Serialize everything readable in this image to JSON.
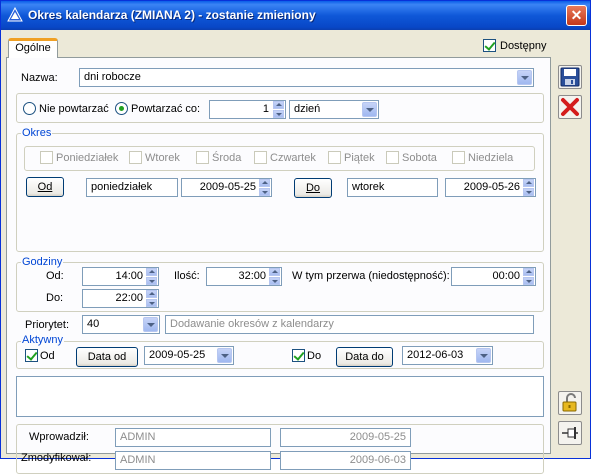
{
  "window": {
    "title": "Okres kalendarza (ZMIANA 2) - zostanie zmieniony"
  },
  "tabs": [
    {
      "label": "Ogólne"
    }
  ],
  "dostepny": {
    "label": "Dostępny",
    "checked": true
  },
  "nazwa": {
    "label": "Nazwa:",
    "value": "dni robocze"
  },
  "repeat": {
    "no_repeat_label": "Nie powtarzać",
    "repeat_label": "Powtarzać co:",
    "selected": "repeat",
    "count": "1",
    "unit": "dzień"
  },
  "okres": {
    "title": "Okres",
    "days": [
      {
        "label": "Poniedziałek",
        "checked": false
      },
      {
        "label": "Wtorek",
        "checked": false
      },
      {
        "label": "Środa",
        "checked": false
      },
      {
        "label": "Czwartek",
        "checked": false
      },
      {
        "label": "Piątek",
        "checked": false
      },
      {
        "label": "Sobota",
        "checked": false
      },
      {
        "label": "Niedziela",
        "checked": false
      }
    ],
    "od_button": "Od",
    "od_day": "poniedziałek",
    "od_date": "2009-05-25",
    "do_button": "Do",
    "do_day": "wtorek",
    "do_date": "2009-05-26"
  },
  "godziny": {
    "title": "Godziny",
    "od_label": "Od:",
    "od_value": "14:00",
    "do_label": "Do:",
    "do_value": "22:00",
    "ilosc_label": "Ilość:",
    "ilosc_value": "32:00",
    "przerwa_label": "W tym przerwa (niedostępność):",
    "przerwa_value": "00:00"
  },
  "priorytet": {
    "label": "Priorytet:",
    "value": "40",
    "description": "Dodawanie okresów z kalendarzy"
  },
  "aktywny": {
    "title": "Aktywny",
    "od_label": "Od",
    "od_checked": true,
    "od_button": "Data od",
    "od_date": "2009-05-25",
    "do_label": "Do",
    "do_checked": true,
    "do_button": "Data do",
    "do_date": "2012-06-03"
  },
  "audit": {
    "wprowadzil_label": "Wprowadził:",
    "wprowadzil_user": "ADMIN",
    "wprowadzil_date": "2009-05-25",
    "zmodyfikowal_label": "Zmodyfikował:",
    "zmodyfikowal_user": "ADMIN",
    "zmodyfikowal_date": "2009-06-03"
  },
  "side_buttons": [
    {
      "icon": "save-icon"
    },
    {
      "icon": "cancel-icon"
    },
    {
      "icon": "unlock-icon"
    },
    {
      "icon": "pin-icon"
    }
  ],
  "colors": {
    "title_bar": "#0a5ee8",
    "group_title": "#0046d5",
    "check_green": "#21a121",
    "close_button": "#c4381a"
  }
}
